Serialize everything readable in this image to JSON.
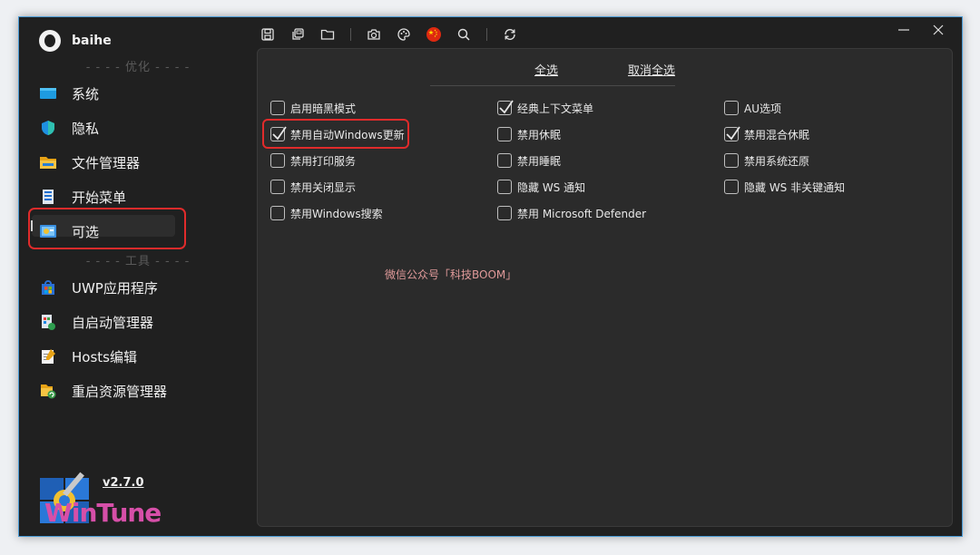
{
  "app": {
    "name": "baihe",
    "version": "v2.7.0",
    "brand": "WinTune"
  },
  "sidebar": {
    "section_optimize": "- - - - 优化 - - - -",
    "section_tools": "- - - - 工具 - - - -",
    "items": [
      {
        "label": "系统",
        "icon": "monitor-icon"
      },
      {
        "label": "隐私",
        "icon": "shield-icon"
      },
      {
        "label": "文件管理器",
        "icon": "folder-icon"
      },
      {
        "label": "开始菜单",
        "icon": "start-menu-icon"
      },
      {
        "label": "可选",
        "icon": "control-panel-icon"
      }
    ],
    "tools": [
      {
        "label": "UWP应用程序",
        "icon": "store-icon"
      },
      {
        "label": "自启动管理器",
        "icon": "startup-icon"
      },
      {
        "label": "Hosts编辑",
        "icon": "notepad-icon"
      },
      {
        "label": "重启资源管理器",
        "icon": "explorer-restart-icon"
      }
    ]
  },
  "toolbar": {
    "icons": [
      "save-icon",
      "copy-icon",
      "open-folder-icon",
      "camera-icon",
      "palette-icon",
      "china-flag-icon",
      "search-icon",
      "refresh-icon"
    ]
  },
  "panel": {
    "select_all": "全选",
    "deselect_all": "取消全选",
    "watermark": "微信公众号「科技BOOM」",
    "options": [
      {
        "label": "启用暗黑模式",
        "checked": false
      },
      {
        "label": "禁用自动Windows更新",
        "checked": true
      },
      {
        "label": "禁用打印服务",
        "checked": false
      },
      {
        "label": "禁用关闭显示",
        "checked": false
      },
      {
        "label": "禁用Windows搜索",
        "checked": false
      },
      {
        "label": "经典上下文菜单",
        "checked": true
      },
      {
        "label": "禁用休眠",
        "checked": false
      },
      {
        "label": "禁用睡眠",
        "checked": false
      },
      {
        "label": "隐藏 WS 通知",
        "checked": false
      },
      {
        "label": "禁用 Microsoft Defender",
        "checked": false
      },
      {
        "label": "AU选项",
        "checked": false
      },
      {
        "label": "禁用混合休眠",
        "checked": true
      },
      {
        "label": "禁用系统还原",
        "checked": false
      },
      {
        "label": "隐藏 WS 非关键通知",
        "checked": false
      }
    ]
  },
  "colors": {
    "highlight": "#e02b2b",
    "accent": "#4a9bd6",
    "background": "#202020",
    "panel": "#2b2b2b"
  }
}
